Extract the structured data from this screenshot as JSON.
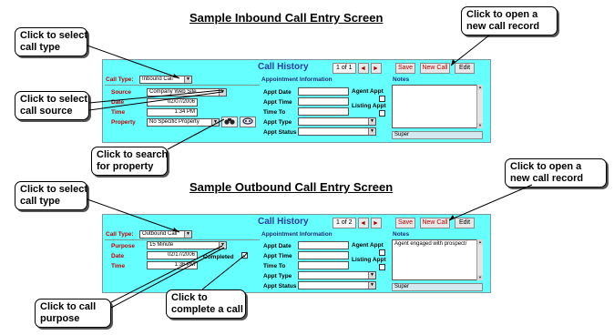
{
  "inbound": {
    "heading": "Sample Inbound Call Entry Screen",
    "panel_title": "Call History",
    "pager": "1 of 1",
    "buttons": {
      "prev": "◄",
      "next": "►",
      "save": "Save",
      "new_call": "New Call",
      "edit": "Edit"
    },
    "call_type_label": "Call Type:",
    "call_type_value": "Inbound Call",
    "appointment_header": "Appointment Information",
    "notes_header": "Notes",
    "notes_text": "",
    "left_fields": [
      {
        "label": "Source",
        "value": "Company Web Site"
      },
      {
        "label": "Date",
        "value": "02/07/2006"
      },
      {
        "label": "Time",
        "value": "1:34 PM"
      },
      {
        "label": "Property",
        "value": "No Specific Property"
      }
    ],
    "appt_labels": {
      "date": "Appt Date",
      "time": "Appt Time",
      "time_to": "Time To",
      "type": "Appt Type",
      "status": "Appt Status",
      "agent": "Agent Appt",
      "listing": "Listing Appt"
    },
    "footer_user": "Super",
    "search_icon": "binoculars-icon",
    "clear_icon": "eraser-icon"
  },
  "outbound": {
    "heading": "Sample Outbound Call Entry Screen",
    "panel_title": "Call History",
    "pager": "1 of 2",
    "buttons": {
      "prev": "◄",
      "next": "►",
      "save": "Save",
      "new_call": "New Call",
      "edit": "Edit"
    },
    "call_type_label": "Call Type:",
    "call_type_value": "Outbound Call",
    "appointment_header": "Appointment Information",
    "notes_header": "Notes",
    "notes_text": "Agent engaged with prospect/",
    "left_fields": [
      {
        "label": "Purpose",
        "value": "15 Minute"
      },
      {
        "label": "Date",
        "value": "02/17/2006"
      },
      {
        "label": "Time",
        "value": "1:36 PM"
      }
    ],
    "completed_label": "Completed",
    "completed_checked": true,
    "appt_labels": {
      "date": "Appt Date",
      "time": "Appt Time",
      "time_to": "Time To",
      "type": "Appt Type",
      "status": "Appt Status",
      "agent": "Agent Appt",
      "listing": "Listing Appt"
    },
    "footer_user": "Super"
  },
  "callouts": {
    "select_call_type_1": [
      "Click to select",
      "call type"
    ],
    "open_new_call_1": [
      "Click to open a",
      "new call record"
    ],
    "select_call_source": [
      "Click to select",
      "call source"
    ],
    "search_property": [
      "Click to search",
      "for property"
    ],
    "select_call_type_2": [
      "Click to select",
      "call type"
    ],
    "open_new_call_2": [
      "Click to open a",
      "new call record"
    ],
    "call_purpose": [
      "Click to call",
      "purpose"
    ],
    "complete_call": [
      "Click to",
      "complete a call"
    ]
  }
}
